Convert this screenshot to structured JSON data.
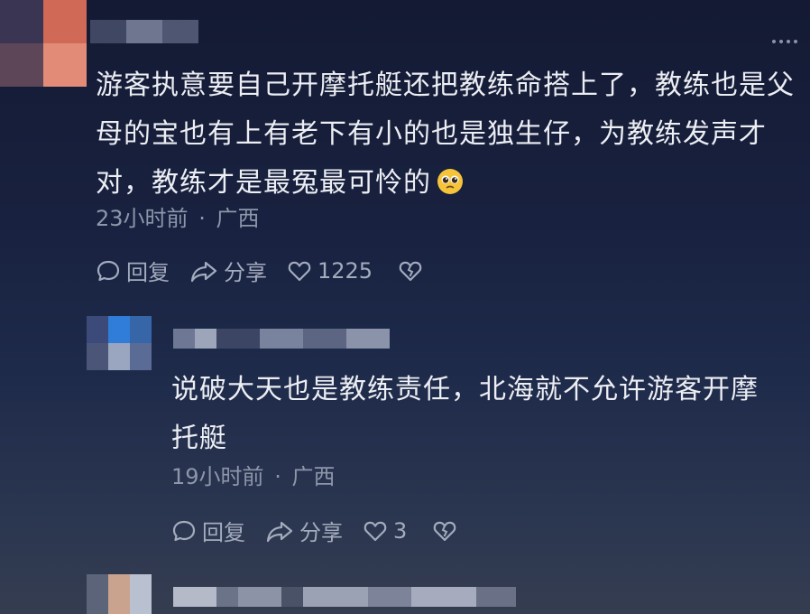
{
  "comment1": {
    "text": "游客执意要自己开摩托艇还把教练命搭上了，教练也是父母的宝也有上有老下有小的也是独生仔，为教练发声才对，教练才是最冤最可怜的",
    "emoji": "pleading-face",
    "time": "23小时前",
    "location": "广西",
    "reply_label": "回复",
    "share_label": "分享",
    "likes": "1225"
  },
  "comment2": {
    "text": "说破大天也是教练责任，北海就不允许游客开摩托艇",
    "time": "19小时前",
    "location": "广西",
    "reply_label": "回复",
    "share_label": "分享",
    "likes": "3"
  },
  "separator": "·"
}
